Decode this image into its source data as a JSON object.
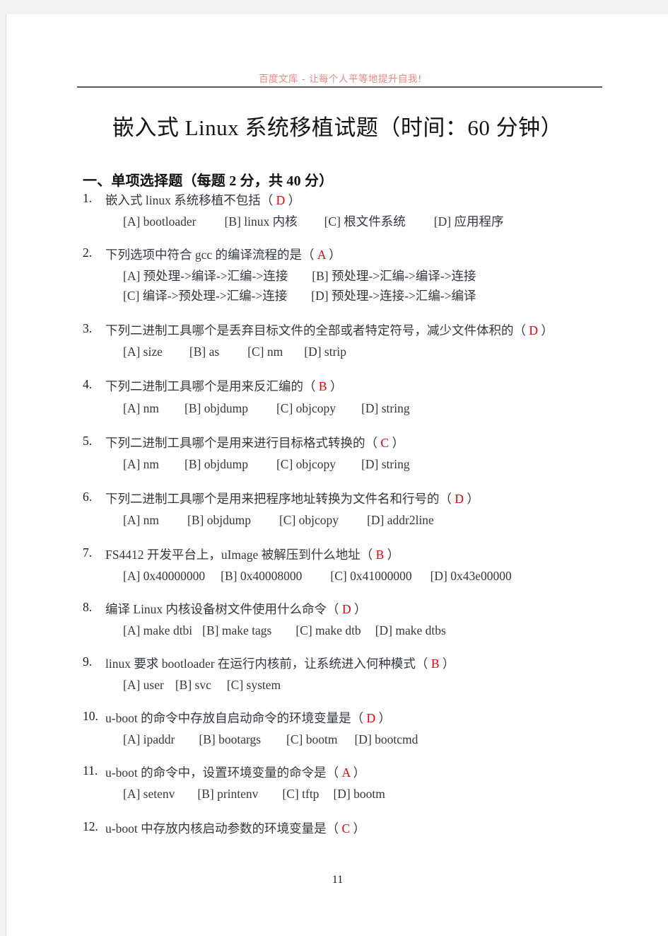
{
  "header": {
    "watermark": "百度文库 - 让每个人平等地提升自我!"
  },
  "title": "嵌入式 Linux 系统移植试题（时间：60 分钟）",
  "section": {
    "heading": "一、单项选择题（每题 2 分，共 40 分）"
  },
  "page_number": "11",
  "questions": [
    {
      "index": "1.",
      "stem": "嵌入式 linux 系统移植不包括（",
      "answer": "D",
      "stem_end": "）",
      "options": [
        "[A] bootloader",
        "[B] linux 内核",
        "[C] 根文件系统",
        "[D] 应用程序"
      ]
    },
    {
      "index": "2.",
      "stem": "下列选项中符合 gcc 的编译流程的是（",
      "answer": "A",
      "stem_end": "）",
      "options": [
        "[A] 预处理->编译->汇编->连接",
        "[B] 预处理->汇编->编译->连接",
        "[C] 编译->预处理->汇编->连接",
        "[D] 预处理->连接->汇编->编译"
      ]
    },
    {
      "index": "3.",
      "stem": "下列二进制工具哪个是丢弃目标文件的全部或者特定符号，减少文件体积的（",
      "answer": "D",
      "stem_end": "）",
      "options": [
        "[A] size",
        "[B] as",
        "[C] nm",
        "[D] strip"
      ]
    },
    {
      "index": "4.",
      "stem": "下列二进制工具哪个是用来反汇编的（",
      "answer": "B",
      "stem_end": "）",
      "options": [
        "[A] nm",
        "[B] objdump",
        "[C] objcopy",
        "[D] string"
      ]
    },
    {
      "index": "5.",
      "stem": "下列二进制工具哪个是用来进行目标格式转换的（",
      "answer": "C",
      "stem_end": "）",
      "options": [
        "[A] nm",
        "[B] objdump",
        "[C] objcopy",
        "[D] string"
      ]
    },
    {
      "index": "6.",
      "stem": "下列二进制工具哪个是用来把程序地址转换为文件名和行号的（",
      "answer": "D",
      "stem_end": "）",
      "options": [
        "[A] nm",
        "[B] objdump",
        "[C] objcopy",
        "[D] addr2line"
      ]
    },
    {
      "index": "7.",
      "stem": "FS4412 开发平台上，uImage 被解压到什么地址（",
      "answer": "B",
      "stem_end": "）",
      "options": [
        "[A] 0x40000000",
        "[B] 0x40008000",
        "[C] 0x41000000",
        "[D] 0x43e00000"
      ]
    },
    {
      "index": "8.",
      "stem": "编译 Linux 内核设备树文件使用什么命令（",
      "answer": "D",
      "stem_end": "）",
      "options": [
        "[A] make dtbi",
        "[B] make tags",
        "[C] make dtb",
        "[D] make dtbs"
      ]
    },
    {
      "index": "9.",
      "stem": "linux 要求 bootloader 在运行内核前，让系统进入何种模式（",
      "answer": "B",
      "stem_end": "）",
      "options": [
        "[A] user",
        "[B] svc",
        "[C] system"
      ]
    },
    {
      "index": "10.",
      "stem": "u-boot 的命令中存放自启动命令的环境变量是（",
      "answer": "D",
      "stem_end": "）",
      "options": [
        "[A] ipaddr",
        "[B] bootargs",
        "[C] bootm",
        "[D] bootcmd"
      ]
    },
    {
      "index": "11.",
      "stem": "u-boot 的命令中，设置环境变量的命令是（",
      "answer": "A",
      "stem_end": "）",
      "options": [
        "[A] setenv",
        "[B] printenv",
        "[C] tftp",
        "[D] bootm"
      ]
    },
    {
      "index": "12.",
      "stem": "u-boot 中存放内核启动参数的环境变量是（",
      "answer": "C",
      "stem_end": "）",
      "options": []
    }
  ]
}
